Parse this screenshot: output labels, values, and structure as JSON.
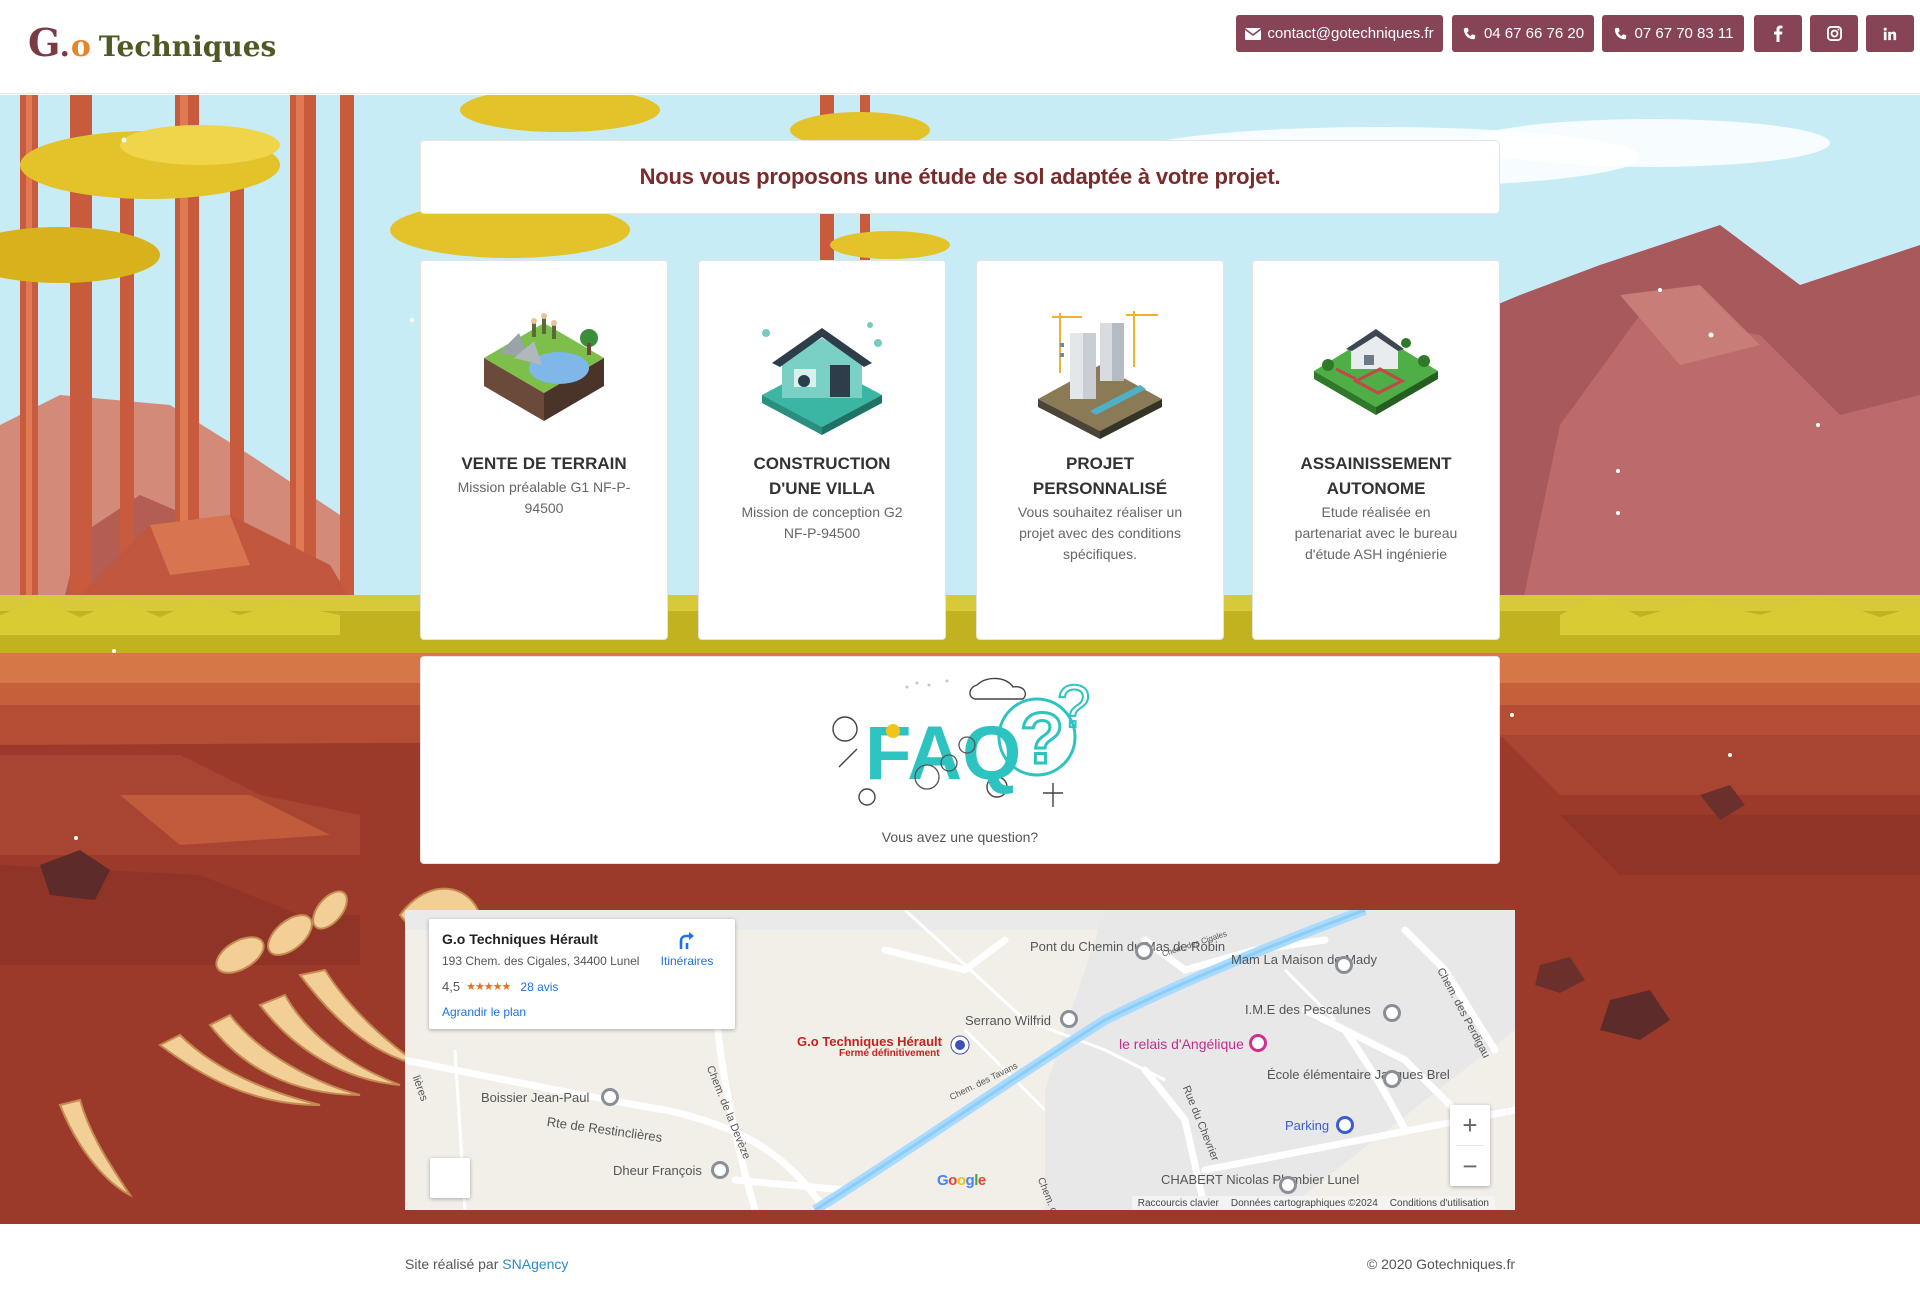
{
  "header": {
    "logo": {
      "g": "G",
      "dot": ".",
      "o": "o",
      "name": "Techniques"
    },
    "email": "contact@gotechniques.fr",
    "phone1": "04 67 66 76 20",
    "phone2": "07 67 70 83 11",
    "social": [
      "facebook-icon",
      "instagram-icon",
      "linkedin-icon"
    ],
    "accent": "#874456"
  },
  "banner": {
    "title": "Nous vous proposons une étude de sol adaptée à votre projet."
  },
  "cards": [
    {
      "title": "VENTE DE TERRAIN",
      "desc": "Mission préalable G1 NF-P-94500"
    },
    {
      "title": "CONSTRUCTION D'UNE VILLA",
      "desc": "Mission de conception G2 NF-P-94500"
    },
    {
      "title": "PROJET PERSONNALISÉ",
      "desc": "Vous souhaitez réaliser un projet avec des conditions spécifiques."
    },
    {
      "title": "ASSAINISSEMENT AUTONOME",
      "desc": "Etude réalisée en partenariat avec le bureau d'étude ASH ingénierie"
    }
  ],
  "faq": {
    "caption": "Vous avez une question?",
    "art": "FAQ"
  },
  "map": {
    "place_name": "G.o Techniques Hérault",
    "address": "193 Chem. des Cigales, 34400 Lunel",
    "rating": "4,5",
    "stars": "★★★★★",
    "reviews": "28 avis",
    "enlarge": "Agrandir le plan",
    "directions": "Itinéraires",
    "marker_name": "G.o Techniques Hérault",
    "marker_status": "Fermé définitivement",
    "labels": {
      "pont": "Pont du Chemin du Mas de Robin",
      "mam": "Mam La Maison de Mady",
      "ime": "I.M.E des Pescalunes",
      "serrano": "Serrano Wilfrid",
      "relais": "le relais d'Angélique",
      "ecole": "École élémentaire Jacques Brel",
      "parking": "Parking",
      "boissier": "Boissier Jean-Paul",
      "rte": "Rte de Restinclières",
      "dheur": "Dheur François",
      "chabert": "CHABERT Nicolas Plombier Lunel",
      "devese": "Chem. de la Devèze",
      "tavans": "Chem. des Tavans",
      "chevrier": "Rue du Chevrier",
      "perdigau": "Chem. des Perdigau",
      "cigales": "Chem. des Cigales",
      "lieres": "lières",
      "chem_d": "Chem. d"
    },
    "google": "Google",
    "footer_keys": "Raccourcis clavier",
    "footer_data": "Données cartographiques ©2024",
    "footer_terms": "Conditions d'utilisation",
    "zoom_in": "+",
    "zoom_out": "−"
  },
  "footer": {
    "left_prefix": "Site réalisé par ",
    "agency": "SNAgency",
    "right": "© 2020 Gotechniques.fr"
  }
}
